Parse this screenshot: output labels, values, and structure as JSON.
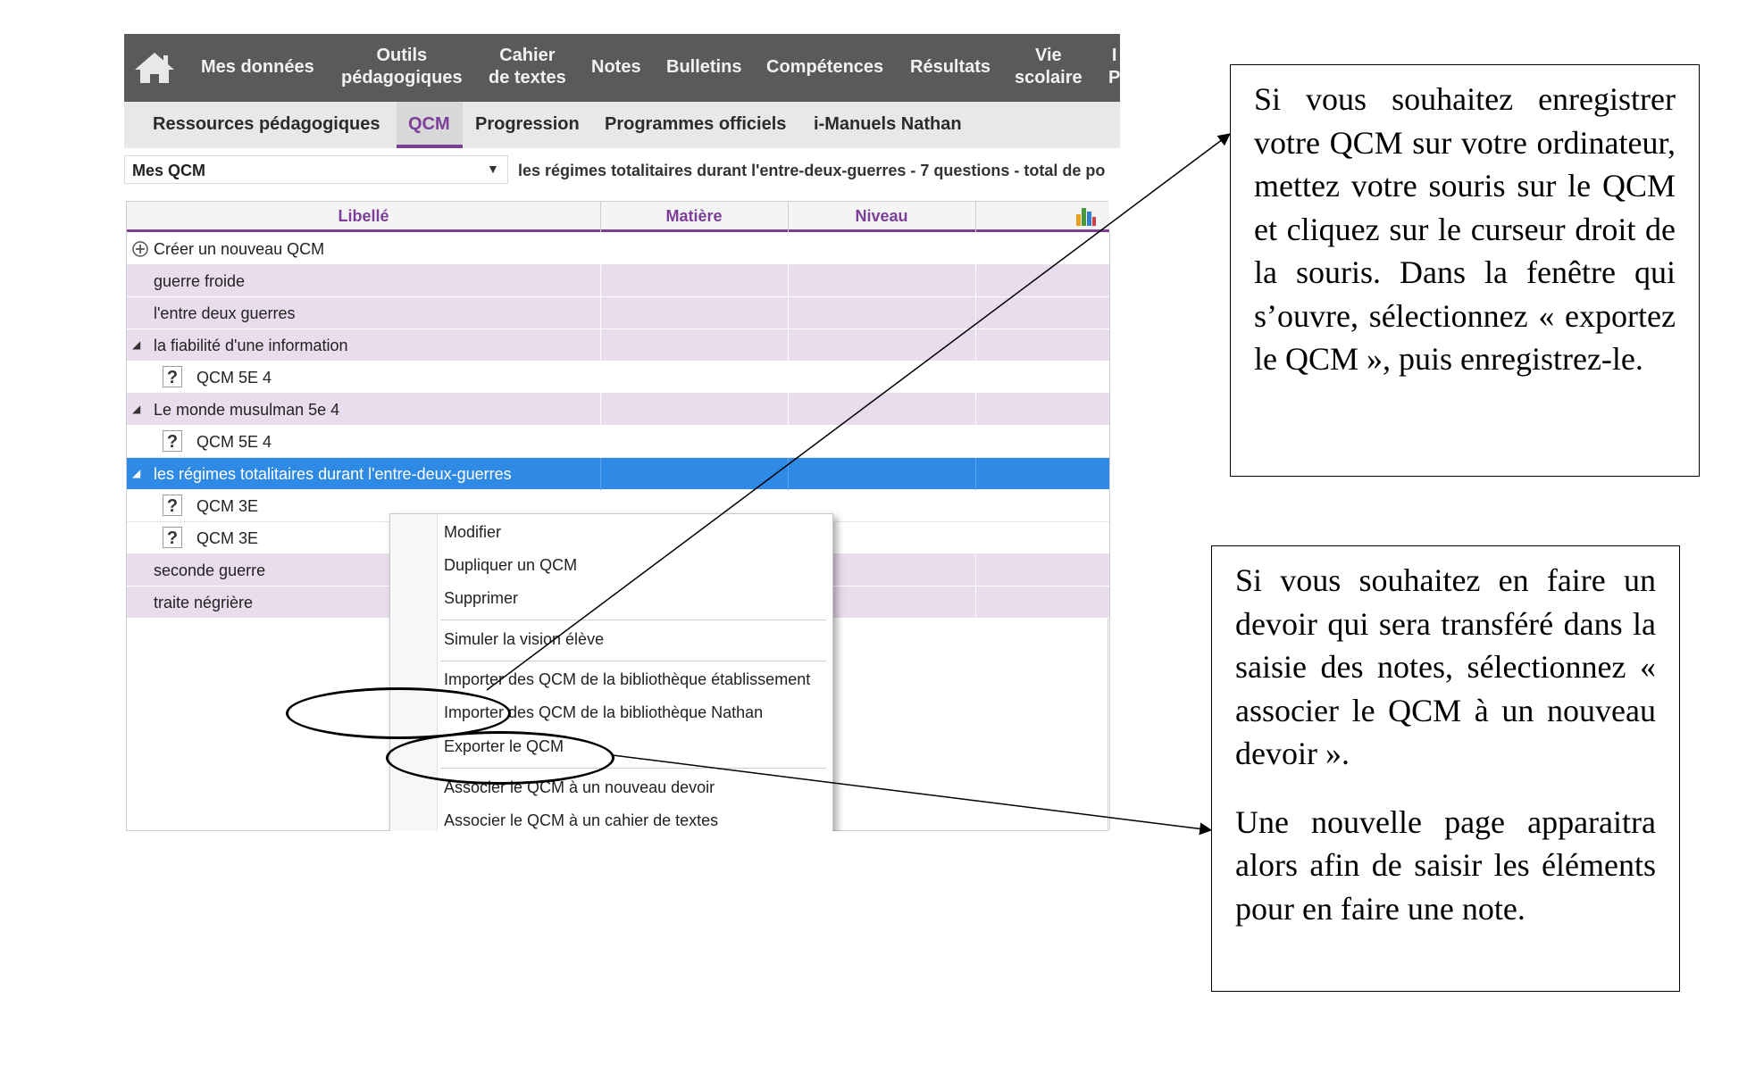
{
  "topnav": {
    "items": [
      {
        "label": "Mes données"
      },
      {
        "label_line1": "Outils",
        "label_line2": "pédagogiques"
      },
      {
        "label_line1": "Cahier",
        "label_line2": "de textes"
      },
      {
        "label": "Notes"
      },
      {
        "label": "Bulletins"
      },
      {
        "label": "Compétences"
      },
      {
        "label": "Résultats"
      },
      {
        "label_line1": "Vie",
        "label_line2": "scolaire"
      },
      {
        "label_line1": "I",
        "label_line2": "P"
      }
    ]
  },
  "subnav": {
    "tabs": [
      {
        "label": "Ressources pédagogiques"
      },
      {
        "label": "QCM",
        "active": true
      },
      {
        "label": "Progression"
      },
      {
        "label": "Programmes officiels"
      },
      {
        "label": "i-Manuels Nathan"
      }
    ]
  },
  "selector": {
    "value": "Mes QCM",
    "summary": "les régimes totalitaires durant l'entre-deux-guerres - 7 questions - total de po"
  },
  "table": {
    "columns": [
      "Libellé",
      "Matière",
      "Niveau"
    ],
    "create_label": "Créer un nouveau QCM",
    "rows": [
      {
        "label": "guerre froide"
      },
      {
        "label": "l'entre deux guerres"
      },
      {
        "label": "la fiabilité d'une information"
      },
      {
        "label": "QCM  5E 4"
      },
      {
        "label": "Le monde musulman 5e 4"
      },
      {
        "label": "QCM  5E 4"
      },
      {
        "label": "les régimes totalitaires durant l'entre-deux-guerres"
      },
      {
        "label": "QCM  3E"
      },
      {
        "label": "QCM  3E"
      },
      {
        "label": "seconde guerre"
      },
      {
        "label": "traite négrière"
      }
    ]
  },
  "context_menu": {
    "items": [
      "Modifier",
      "Dupliquer un QCM",
      "Supprimer",
      "Simuler la vision élève",
      "Importer des QCM de la bibliothèque établissement",
      "Importer des QCM de la bibliothèque Nathan",
      "Exporter le QCM",
      "Associer le QCM à un nouveau devoir",
      "Associer le QCM à un cahier de textes"
    ]
  },
  "callouts": {
    "export_text": "Si vous souhaitez enregistrer votre QCM sur votre ordinateur, mettez votre souris sur le QCM et cliquez sur le curseur droit de la souris. Dans la fenêtre qui s’ouvre, sélectionnez « exportez le QCM », puis enregistrez-le.",
    "devoir_text_1": "Si vous souhaitez en faire un devoir qui sera transféré dans la saisie des notes, sélectionnez « associer le QCM à un nouveau devoir ».",
    "devoir_text_2": "Une nouvelle page apparaitra alors afin de saisir les éléments pour en faire une note."
  },
  "colors": {
    "nav_bg": "#5a5a5a",
    "accent": "#7b3f98",
    "row_purple": "#e9dcec",
    "selected_row": "#2f8ae6"
  }
}
